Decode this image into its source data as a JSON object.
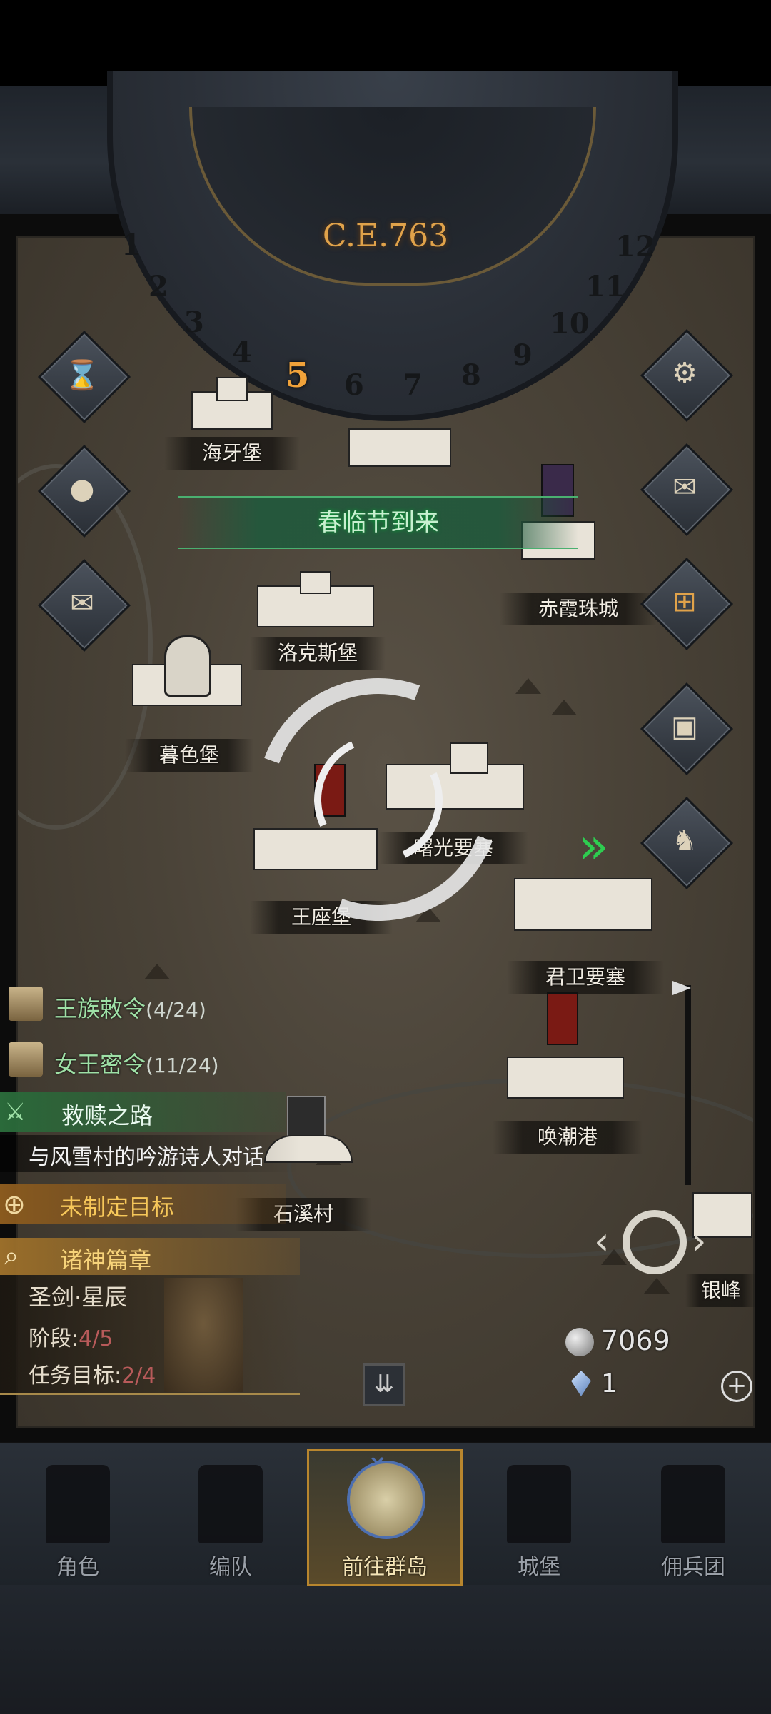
{
  "calendar": {
    "year": "C.E.763",
    "months": [
      "1",
      "2",
      "3",
      "4",
      "5",
      "6",
      "7",
      "8",
      "9",
      "10",
      "11",
      "12"
    ],
    "current_month": "5"
  },
  "event_banner": "春临节到来",
  "locations": [
    {
      "name": "海牙堡"
    },
    {
      "name": "赤霞珠城"
    },
    {
      "name": "洛克斯堡"
    },
    {
      "name": "暮色堡"
    },
    {
      "name": "曙光要塞"
    },
    {
      "name": "王座堡"
    },
    {
      "name": "君卫要塞"
    },
    {
      "name": "唤潮港"
    },
    {
      "name": "石溪村"
    },
    {
      "name": "银峰"
    }
  ],
  "side_buttons": {
    "left": [
      "hourglass-icon",
      "money-bag-icon",
      "scroll-icon"
    ],
    "right": [
      "gear-icon",
      "mail-icon",
      "window-icon",
      "supplies-icon",
      "knight-icon"
    ]
  },
  "quests": {
    "royal_decree": {
      "title": "王族敕令",
      "progress": "(4/24)"
    },
    "queen_secret": {
      "title": "女王密令",
      "progress": "(11/24)"
    },
    "mission": {
      "title": "救赎之路",
      "subtitle": "与风雪村的吟游诗人对话"
    },
    "goal": {
      "title": "未制定目标"
    },
    "chapter": {
      "title": "诸神篇章",
      "name": "圣剑·星辰",
      "stage_label": "阶段:",
      "stage_value": "4/5",
      "target_label": "任务目标:",
      "target_value": "2/4"
    }
  },
  "currency": {
    "silver": "7069",
    "gems": "1"
  },
  "nav": [
    {
      "label": "角色"
    },
    {
      "label": "编队"
    },
    {
      "label": "前往群岛"
    },
    {
      "label": "城堡"
    },
    {
      "label": "佣兵团"
    }
  ],
  "colors": {
    "accent_gold": "#e0a24a",
    "event_green": "#4ab070",
    "quest_green": "#9ee0a6",
    "stage_red": "#b85a5a"
  }
}
